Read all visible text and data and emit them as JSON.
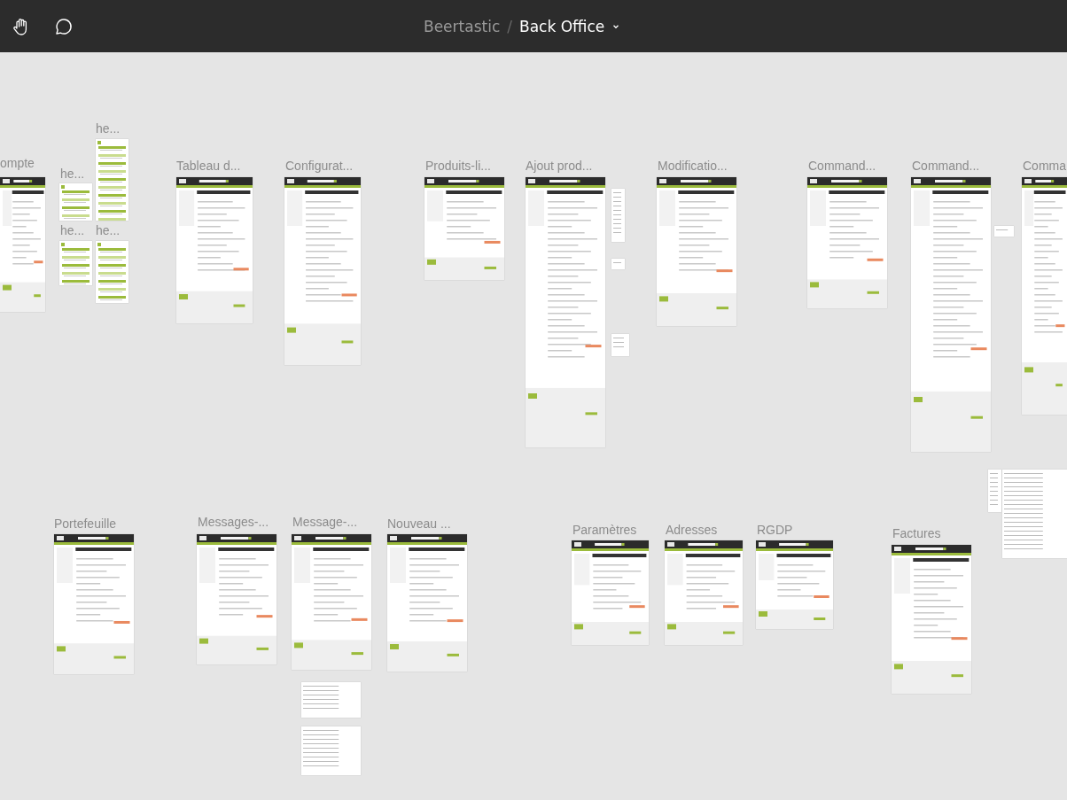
{
  "breadcrumb": {
    "project": "Beertastic",
    "separator": "/",
    "page": "Back Office"
  },
  "frames": [
    {
      "kind": "page",
      "label": "ompte"
    },
    {
      "kind": "page",
      "label": "he..."
    },
    {
      "kind": "page",
      "label": "he..."
    },
    {
      "kind": "page",
      "label": "he..."
    },
    {
      "kind": "page",
      "label": "he..."
    },
    {
      "kind": "page",
      "label": "Tableau d..."
    },
    {
      "kind": "page",
      "label": "Configurat..."
    },
    {
      "kind": "page",
      "label": "Produits-li..."
    },
    {
      "kind": "page",
      "label": "Ajout prod..."
    },
    {
      "kind": "page",
      "label": "Modificatio..."
    },
    {
      "kind": "page",
      "label": "Command..."
    },
    {
      "kind": "page",
      "label": "Command..."
    },
    {
      "kind": "page",
      "label": "Comma"
    },
    {
      "kind": "page",
      "label": "Portefeuille"
    },
    {
      "kind": "page",
      "label": "Messages-..."
    },
    {
      "kind": "page",
      "label": "Message-..."
    },
    {
      "kind": "page",
      "label": "Nouveau ..."
    },
    {
      "kind": "page",
      "label": "Paramètres"
    },
    {
      "kind": "page",
      "label": "Adresses"
    },
    {
      "kind": "page",
      "label": "RGDP"
    },
    {
      "kind": "page",
      "label": "Factures"
    },
    {
      "kind": "snippet"
    },
    {
      "kind": "snippet"
    },
    {
      "kind": "snippet"
    },
    {
      "kind": "snippet"
    },
    {
      "kind": "snippet"
    },
    {
      "kind": "snippet"
    },
    {
      "kind": "snippet"
    },
    {
      "kind": "snippet"
    }
  ]
}
